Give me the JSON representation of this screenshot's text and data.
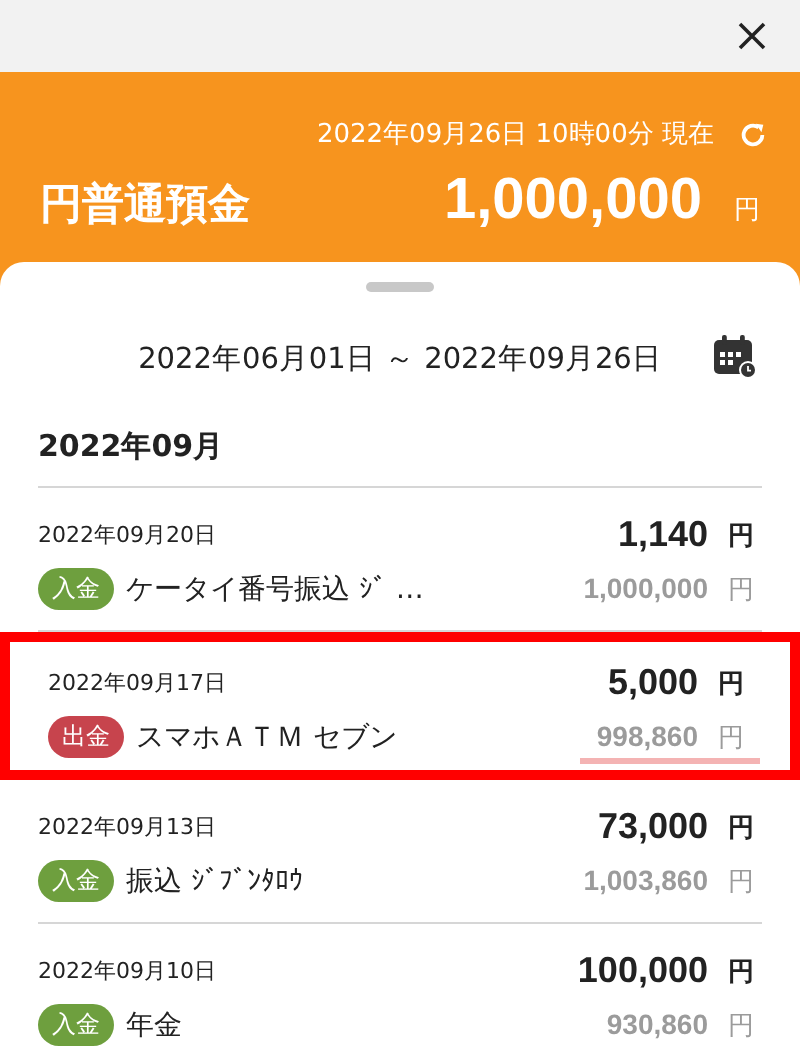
{
  "header": {
    "timestamp": "2022年09月26日 10時00分 現在",
    "account": "円普通預金",
    "balance": "1,000,000",
    "currency": "円"
  },
  "period": "2022年06月01日 ～ 2022年09月26日",
  "month": "2022年09月",
  "transactions": [
    {
      "date": "2022年09月20日",
      "kind": "deposit",
      "tag": "入金",
      "description": "ケータイ番号振込 ｼﾞ …",
      "amount": "1,140",
      "amount_unit": "円",
      "balance": "1,000,000",
      "balance_unit": "円",
      "highlighted": false
    },
    {
      "date": "2022年09月17日",
      "kind": "withdrawal",
      "tag": "出金",
      "description": "スマホＡＴＭ セブン",
      "amount": "5,000",
      "amount_unit": "円",
      "balance": "998,860",
      "balance_unit": "円",
      "highlighted": true
    },
    {
      "date": "2022年09月13日",
      "kind": "deposit",
      "tag": "入金",
      "description": "振込 ｼﾞﾌﾞﾝﾀﾛｳ",
      "amount": "73,000",
      "amount_unit": "円",
      "balance": "1,003,860",
      "balance_unit": "円",
      "highlighted": false
    },
    {
      "date": "2022年09月10日",
      "kind": "deposit",
      "tag": "入金",
      "description": "年金",
      "amount": "100,000",
      "amount_unit": "円",
      "balance": "930,860",
      "balance_unit": "円",
      "highlighted": false
    }
  ]
}
